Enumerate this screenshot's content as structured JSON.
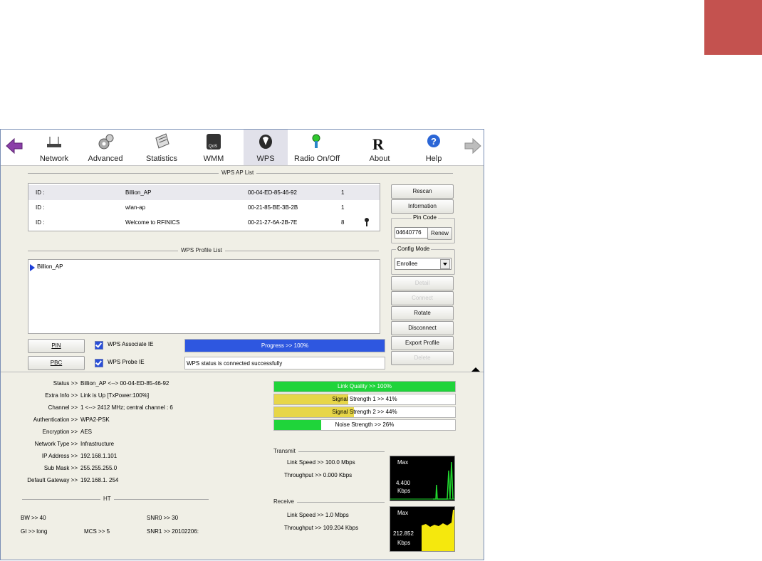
{
  "toolbar": {
    "items": [
      {
        "label": "Network",
        "icon": "router-icon"
      },
      {
        "label": "Advanced",
        "icon": "gears-icon"
      },
      {
        "label": "Statistics",
        "icon": "notepad-icon"
      },
      {
        "label": "WMM",
        "icon": "qos-icon"
      },
      {
        "label": "WPS",
        "icon": "wps-icon"
      },
      {
        "label": "Radio On/Off",
        "icon": "radio-icon"
      },
      {
        "label": "About",
        "icon": "ralink-icon"
      },
      {
        "label": "Help",
        "icon": "help-icon"
      }
    ],
    "selected": "WPS"
  },
  "ap_list": {
    "title": "WPS AP List",
    "rows": [
      {
        "id": "ID :",
        "ssid": "Billion_AP",
        "mac": "00-04-ED-85-46-92",
        "channel": "1"
      },
      {
        "id": "ID :",
        "ssid": "wlan-ap",
        "mac": "00-21-85-BE-3B-2B",
        "channel": "1"
      },
      {
        "id": "ID :",
        "ssid": "Welcome to RFINICS",
        "mac": "00-21-27-6A-2B-7E",
        "channel": "8"
      }
    ]
  },
  "profile_list": {
    "title": "WPS Profile List",
    "items": [
      "Billion_AP"
    ]
  },
  "buttons": {
    "rescan": "Rescan",
    "information": "Information",
    "renew": "Renew",
    "detail": "Detail",
    "connect": "Connect",
    "rotate": "Rotate",
    "disconnect": "Disconnect",
    "export_profile": "Export Profile",
    "delete": "Delete",
    "pin": "PIN",
    "pbc": "PBC"
  },
  "pin_code": {
    "title": "Pin Code",
    "value": "04640776"
  },
  "config_mode": {
    "title": "Config Mode",
    "value": "Enrollee"
  },
  "checks": {
    "associate_ie": "WPS Associate IE",
    "probe_ie": "WPS Probe IE"
  },
  "progress": {
    "text": "Progress >> 100%",
    "fraction": 1.0
  },
  "wps_status": "WPS status is connected successfully",
  "status": {
    "rows": [
      {
        "k": "Status >>",
        "v": "Billion_AP <--> 00-04-ED-85-46-92"
      },
      {
        "k": "Extra Info >>",
        "v": "Link is Up [TxPower:100%]"
      },
      {
        "k": "Channel >>",
        "v": "1 <--> 2412 MHz; central channel : 6"
      },
      {
        "k": "Authentication >>",
        "v": "WPA2-PSK"
      },
      {
        "k": "Encryption >>",
        "v": "AES"
      },
      {
        "k": "Network Type >>",
        "v": "Infrastructure"
      },
      {
        "k": "IP Address >>",
        "v": "192.168.1.101"
      },
      {
        "k": "Sub Mask >>",
        "v": "255.255.255.0"
      },
      {
        "k": "Default Gateway >>",
        "v": "192.168.1. 254"
      }
    ]
  },
  "ht": {
    "title": "HT",
    "bw": "BW >> 40",
    "gi": "GI >> long",
    "mcs": "MCS >> 5",
    "snr0": "SNR0 >> 30",
    "snr1": "SNR1 >> 20102206:"
  },
  "quality": [
    {
      "text": "Link Quality >> 100%",
      "fraction": 1.0,
      "color": "#1fd43a"
    },
    {
      "text": "Signal Strength 1 >> 41%",
      "fraction": 0.41,
      "color": "#e7d648"
    },
    {
      "text": "Signal Strength 2 >> 44%",
      "fraction": 0.44,
      "color": "#e7d648"
    },
    {
      "text": "Noise Strength >> 26%",
      "fraction": 0.26,
      "color": "#1fd43a"
    }
  ],
  "transmit": {
    "title": "Transmit",
    "link_speed": "Link Speed >> 100.0 Mbps",
    "throughput": "Throughput >> 0.000 Kbps",
    "graph_max": "Max",
    "graph_value": "4.400",
    "graph_unit": "Kbps"
  },
  "receive": {
    "title": "Receive",
    "link_speed": "Link Speed >> 1.0 Mbps",
    "throughput": "Throughput >> 109.204 Kbps",
    "graph_max": "Max",
    "graph_value": "212.852",
    "graph_unit": "Kbps"
  },
  "colors": {
    "corner": "#c4524f",
    "selected_tab": "#e1e1ea",
    "progress": "#2e57e0",
    "link_green": "#1fd43a",
    "signal_yellow": "#e7d648"
  }
}
